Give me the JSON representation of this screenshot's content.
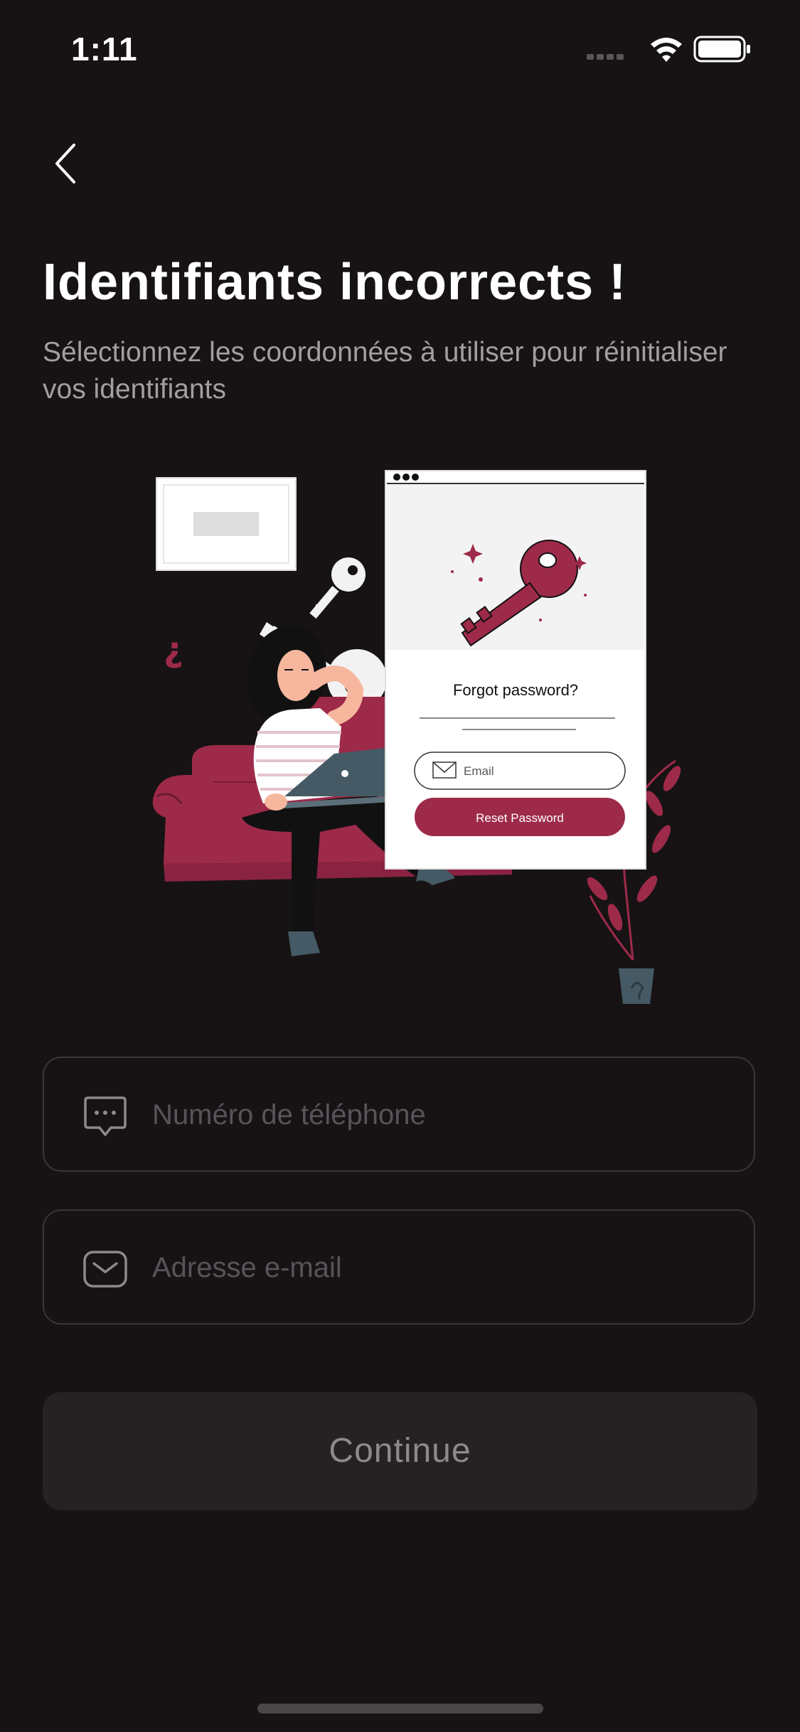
{
  "status_bar": {
    "time": "1:11",
    "icons": [
      "cellular-signal-icon",
      "wifi-icon",
      "battery-icon"
    ]
  },
  "navigation": {
    "back_icon": "chevron-left-icon"
  },
  "header": {
    "title": "Identifiants incorrects !",
    "subtitle": "Sélectionnez les coordonnées à utiliser pour réinitialiser vos identifiants"
  },
  "illustration": {
    "card_title": "Forgot password?",
    "email_placeholder": "Email",
    "reset_label": "Reset Password",
    "question_mark": "¿"
  },
  "form": {
    "phone": {
      "icon": "message-bubble-icon",
      "placeholder": "Numéro de téléphone"
    },
    "email": {
      "icon": "envelope-icon",
      "placeholder": "Adresse e-mail"
    }
  },
  "actions": {
    "continue_label": "Continue"
  },
  "colors": {
    "background": "#171314",
    "accent": "#9e2a4a",
    "field_border": "#3b3538",
    "button_bg": "#262123",
    "muted_text": "#a39fa1"
  }
}
